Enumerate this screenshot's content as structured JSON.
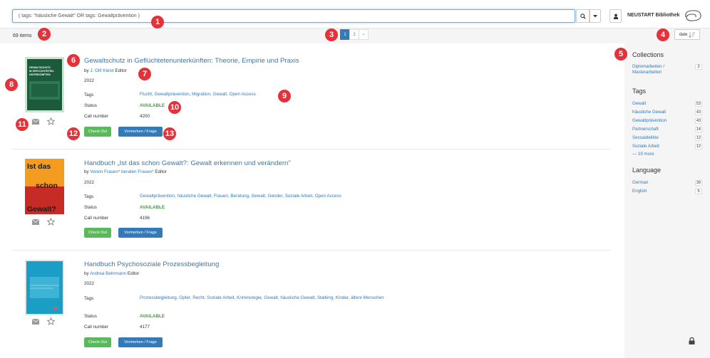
{
  "search": {
    "value": "( tags: \"häusliche Gewalt\" OR tags: Gewaltprävention )",
    "placeholder": ""
  },
  "brand": {
    "name": "NEUSTART Bibliothek"
  },
  "results": {
    "count": "69 items",
    "pages": [
      "1",
      "2"
    ],
    "next": "›",
    "sort_label": "date"
  },
  "sidebar": {
    "collections_title": "Collections",
    "collections": [
      {
        "label": "Diplomarbeiten / Masterarbeiten",
        "count": "3"
      }
    ],
    "tags_title": "Tags",
    "tags": [
      {
        "label": "Gewalt",
        "count": "53"
      },
      {
        "label": "häusliche Gewalt",
        "count": "43"
      },
      {
        "label": "Gewaltprävention",
        "count": "43"
      },
      {
        "label": "Partnerschaft",
        "count": "14"
      },
      {
        "label": "Sexualdelikte",
        "count": "12"
      },
      {
        "label": "Soziale Arbeit",
        "count": "12"
      }
    ],
    "tags_more": "— 19 more",
    "language_title": "Language",
    "languages": [
      {
        "label": "German",
        "count": "39"
      },
      {
        "label": "English",
        "count": "5"
      }
    ]
  },
  "labels": {
    "tags": "Tags",
    "status": "Status",
    "call_number": "Call number",
    "checkout": "Check Out",
    "reserve": "Vormerken / Frage",
    "by": "by",
    "editor": "Editor"
  },
  "items": [
    {
      "title": "Gewaltschutz in Geflüchtetenunterkünften: Theorie, Empirie und Praxis",
      "author": "J. Olif Kleist",
      "year": "2022",
      "tags": "Flucht, Gewaltprävention, Migration, Gewalt, Open Access",
      "status": "AVAILABLE",
      "call_number": "4200",
      "cover_title": "GEWALTSCHUTZ IN GEFLÜCHTETEN-UNTERKÜNFTEN"
    },
    {
      "title": "Handbuch „Ist das schon Gewalt?: Gewalt erkennen und verändern\"",
      "author": "Verein Frauen* beraten Frauen*",
      "year": "2022",
      "tags": "Gewaltprävention, häusliche Gewalt, Frauen, Beratung, Gewalt, Gender, Soziale Arbeit, Open Access",
      "status": "AVAILABLE",
      "call_number": "4196",
      "cover_title": "Ist das schon Gewalt?"
    },
    {
      "title": "Handbuch Psychosoziale Prozessbegleitung",
      "author": "Andrea Behrmann",
      "year": "2022",
      "tags": "Prozessbegleitung, Opfer, Recht, Soziale Arbeit, Kriminologie, Gewalt, häusliche Gewalt, Stalking, Kinder, ältere Menschen",
      "status": "AVAILABLE",
      "call_number": "4177"
    }
  ],
  "markers": [
    "1",
    "2",
    "3",
    "4",
    "5",
    "6",
    "7",
    "8",
    "9",
    "10",
    "11",
    "12",
    "13"
  ],
  "colors": {
    "accent": "#337ab7",
    "available": "#3c9d3c",
    "checkout": "#5cb85c",
    "marker": "#e4323b"
  }
}
